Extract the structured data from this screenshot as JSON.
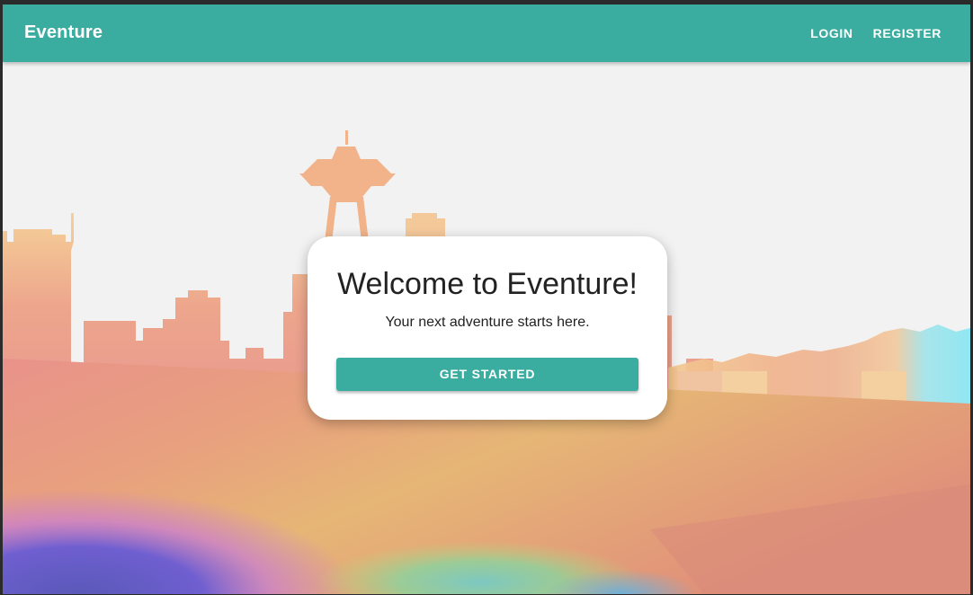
{
  "appbar": {
    "brand": "Eventure",
    "nav": {
      "login_label": "LOGIN",
      "register_label": "REGISTER"
    }
  },
  "hero": {
    "title": "Welcome to Eventure!",
    "subtitle": "Your next adventure starts here.",
    "cta_label": "GET STARTED",
    "background_description": "Watercolor rainbow Seattle skyline with Space Needle"
  },
  "colors": {
    "primary": "#3aada0",
    "page_background": "#f2f2f2",
    "card_background": "#ffffff",
    "text": "#222222"
  }
}
